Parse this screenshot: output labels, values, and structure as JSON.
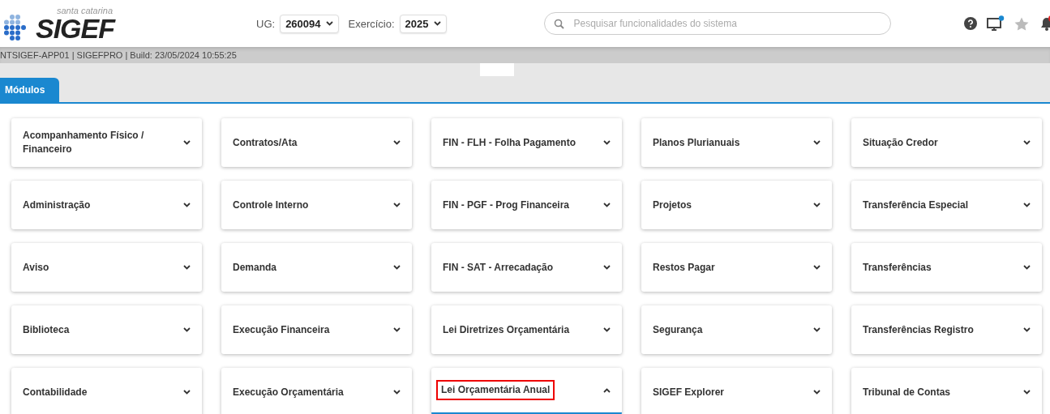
{
  "header": {
    "logo_tagline": "santa catarina",
    "logo_text": "SIGEF",
    "ug_label": "UG:",
    "ug_value": "260094",
    "exercicio_label": "Exercício:",
    "exercicio_value": "2025",
    "search": {
      "placeholder": "Pesquisar funcionalidades do sistema"
    },
    "monitor_notification": true,
    "bell_badge": true
  },
  "build_info": "NTSIGEF-APP01 | SIGEFPRO | Build: 23/05/2024 10:55:25",
  "tabs": [
    {
      "label": "Módulos",
      "selected": true
    }
  ],
  "module_columns": [
    [
      {
        "label": "Acompanhamento Físico / Financeiro",
        "expanded": false,
        "highlighted": false
      },
      {
        "label": "Administração",
        "expanded": false,
        "highlighted": false
      },
      {
        "label": "Aviso",
        "expanded": false,
        "highlighted": false
      },
      {
        "label": "Biblioteca",
        "expanded": false,
        "highlighted": false
      },
      {
        "label": "Contabilidade",
        "expanded": false,
        "highlighted": false
      }
    ],
    [
      {
        "label": "Contratos/Ata",
        "expanded": false,
        "highlighted": false
      },
      {
        "label": "Controle Interno",
        "expanded": false,
        "highlighted": false
      },
      {
        "label": "Demanda",
        "expanded": false,
        "highlighted": false
      },
      {
        "label": "Execução Financeira",
        "expanded": false,
        "highlighted": false
      },
      {
        "label": "Execução Orçamentária",
        "expanded": false,
        "highlighted": false
      }
    ],
    [
      {
        "label": "FIN - FLH - Folha Pagamento",
        "expanded": false,
        "highlighted": false
      },
      {
        "label": "FIN - PGF - Prog Financeira",
        "expanded": false,
        "highlighted": false
      },
      {
        "label": "FIN - SAT - Arrecadação",
        "expanded": false,
        "highlighted": false
      },
      {
        "label": "Lei Diretrizes Orçamentária",
        "expanded": false,
        "highlighted": false
      },
      {
        "label": "Lei Orçamentária Anual",
        "expanded": true,
        "highlighted": true
      }
    ],
    [
      {
        "label": "Planos Plurianuais",
        "expanded": false,
        "highlighted": false
      },
      {
        "label": "Projetos",
        "expanded": false,
        "highlighted": false
      },
      {
        "label": "Restos Pagar",
        "expanded": false,
        "highlighted": false
      },
      {
        "label": "Segurança",
        "expanded": false,
        "highlighted": false
      },
      {
        "label": "SIGEF Explorer",
        "expanded": false,
        "highlighted": false
      }
    ],
    [
      {
        "label": "Situação Credor",
        "expanded": false,
        "highlighted": false
      },
      {
        "label": "Transferência Especial",
        "expanded": false,
        "highlighted": false
      },
      {
        "label": "Transferências",
        "expanded": false,
        "highlighted": false
      },
      {
        "label": "Transferências Registro",
        "expanded": false,
        "highlighted": false
      },
      {
        "label": "Tribunal de Contas",
        "expanded": false,
        "highlighted": false
      }
    ]
  ]
}
